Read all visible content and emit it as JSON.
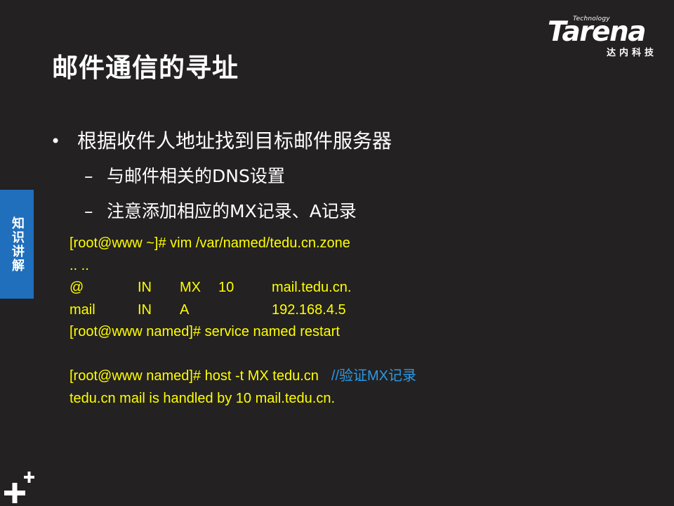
{
  "logo": {
    "tagline": "Technology",
    "brand": "Tarena",
    "subtitle": "达内科技"
  },
  "title": "邮件通信的寻址",
  "side_tab": {
    "label": "知识讲解"
  },
  "bullets": [
    {
      "marker": "•",
      "text": "根据收件人地址找到目标邮件服务器"
    }
  ],
  "sub_bullets": [
    {
      "marker": "–",
      "text": "与邮件相关的DNS设置"
    },
    {
      "marker": "–",
      "text": "注意添加相应的MX记录、A记录"
    }
  ],
  "code": {
    "line1": "[root@www ~]# vim  /var/named/tedu.cn.zone",
    "line2": ".. ..",
    "record1": {
      "name": "@",
      "class": "IN",
      "type": "MX",
      "priority": "10",
      "value": "mail.tedu.cn."
    },
    "record2": {
      "name": "mail",
      "class": "IN",
      "type": "A",
      "priority": "",
      "value": "192.168.4.5"
    },
    "line5": "[root@www named]# service  named  restart",
    "line7": "[root@www named]# host  -t  MX  tedu.cn",
    "comment7": "//验证MX记录",
    "line8": "tedu.cn mail is handled by 10 mail.tedu.cn."
  },
  "colors": {
    "background": "#232122",
    "code_text": "#ffff00",
    "comment": "#2b9ae6",
    "side_tab": "#1f6fbd"
  },
  "icons": {
    "corner": "plus-plus-icon"
  }
}
